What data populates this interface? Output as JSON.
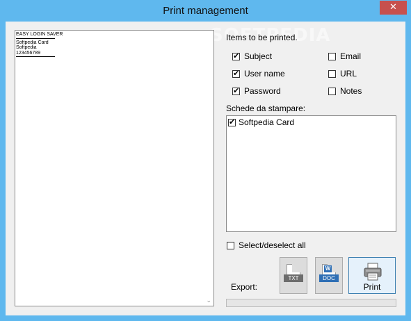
{
  "window": {
    "title": "Print management",
    "close_glyph": "✕"
  },
  "watermark": "SOFTPEDIA",
  "preview": {
    "heading": "EASY LOGIN SAVER",
    "lines": [
      "Softpedia Card",
      "Softpedia",
      "123456789"
    ],
    "scroll_arrow": "⌄"
  },
  "items": {
    "label": "Items to be printed.",
    "options": [
      {
        "label": "Subject",
        "checked": true
      },
      {
        "label": "Email",
        "checked": false
      },
      {
        "label": "User name",
        "checked": true
      },
      {
        "label": "URL",
        "checked": false
      },
      {
        "label": "Password",
        "checked": true
      },
      {
        "label": "Notes",
        "checked": false
      }
    ]
  },
  "cards": {
    "label": "Schede da stampare:",
    "list": [
      {
        "label": "Softpedia Card",
        "checked": true
      }
    ]
  },
  "select_all": {
    "label": "Select/deselect all",
    "checked": false
  },
  "export": {
    "label": "Export:",
    "txt_tag": "TXT",
    "doc_tag": "DOC",
    "word_letter": "W"
  },
  "print": {
    "label": "Print"
  },
  "progress": {
    "value": 0
  },
  "colors": {
    "title_bar": "#5fb8ee",
    "close_button": "#c7504d",
    "doc_blue": "#2f6fb5"
  }
}
